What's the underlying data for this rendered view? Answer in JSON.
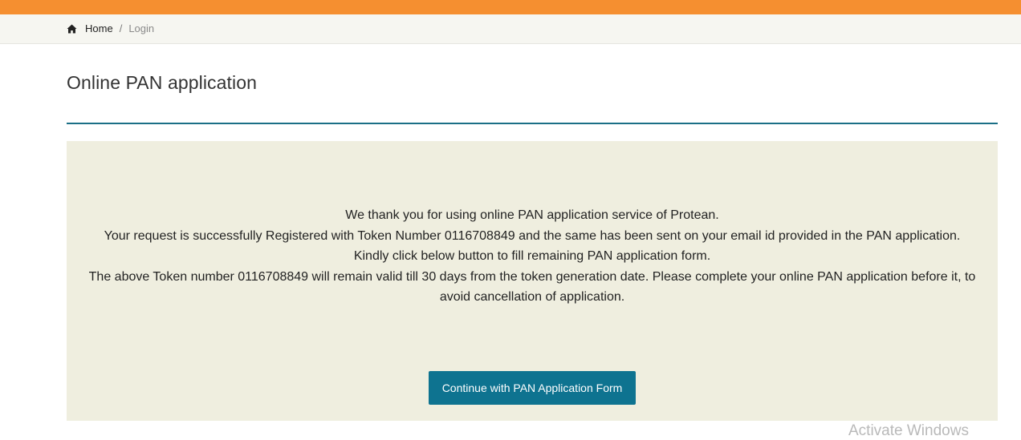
{
  "breadcrumb": {
    "home_label": "Home",
    "separator": "/",
    "current_label": "Login",
    "home_icon": "home-icon"
  },
  "page": {
    "title": "Online PAN application"
  },
  "message": {
    "line1": "We thank you for using online PAN application service of Protean.",
    "line2": "Your request is successfully Registered with Token Number 0116708849 and the same has been sent on your email id provided in the PAN application.",
    "line3": "Kindly click below button to fill remaining PAN application form.",
    "line4a": "The above Token number 0116708849 will remain valid till 30 days from the token generation date. Please complete your online PAN application before it, to",
    "line4b": "avoid cancellation of application."
  },
  "actions": {
    "continue_label": "Continue with PAN Application Form"
  },
  "os_watermark": {
    "text": "Activate Windows"
  },
  "colors": {
    "header_accent": "#f58f30",
    "title_rule": "#1b6f86",
    "panel_background": "#efeedf",
    "button_background": "#0e7390"
  }
}
